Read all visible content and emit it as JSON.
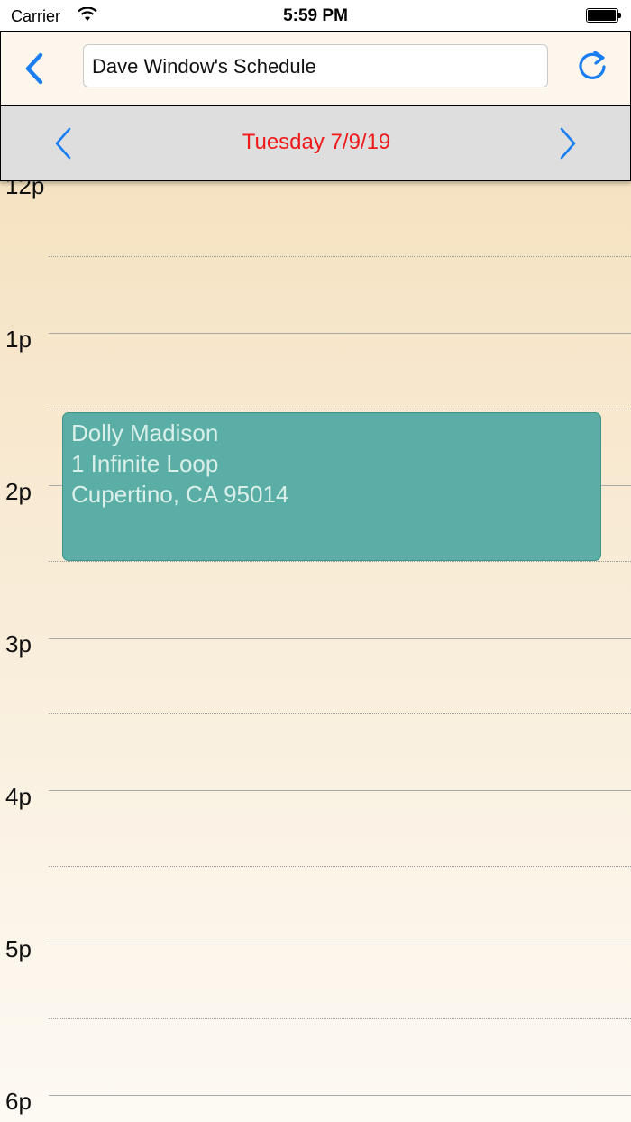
{
  "status_bar": {
    "carrier": "Carrier",
    "time": "5:59 PM"
  },
  "header": {
    "title": "Dave Window's Schedule",
    "back_icon": "chevron-left-icon",
    "refresh_icon": "refresh-icon",
    "accent_color": "#1a7ef2"
  },
  "date_bar": {
    "date": "Tuesday 7/9/19",
    "date_color": "#ee1b1b",
    "prev_icon": "chevron-left-icon",
    "next_icon": "chevron-right-icon"
  },
  "timeline": {
    "hours": [
      "12p",
      "1p",
      "2p",
      "3p",
      "4p",
      "5p",
      "6p"
    ]
  },
  "events": [
    {
      "name": "Dolly Madison",
      "street": "1 Infinite Loop",
      "city": "Cupertino, CA 95014",
      "color": "#5aaea5"
    }
  ]
}
